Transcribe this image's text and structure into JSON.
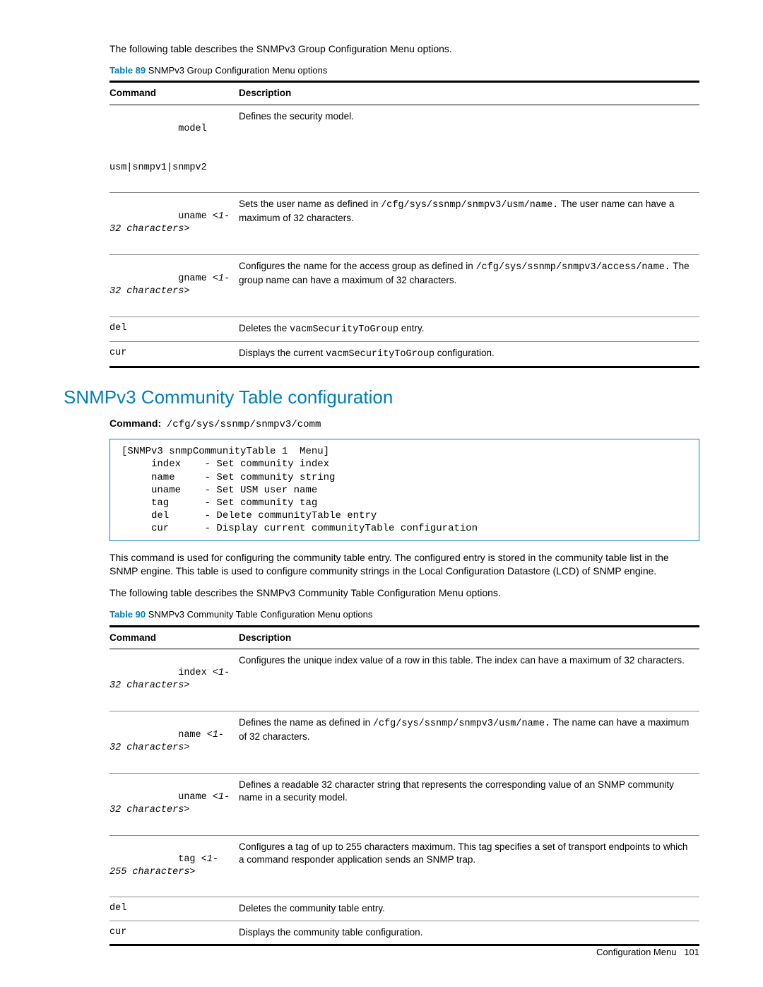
{
  "para_intro": "The following table describes the SNMPv3 Group Configuration Menu options.",
  "table89": {
    "caption_num": "Table 89",
    "caption_text": "SNMPv3 Group Configuration Menu options",
    "head_cmd": "Command",
    "head_desc": "Description",
    "rows": {
      "r0": {
        "cmd1": "model",
        "cmd2": "usm|snmpv1|snmpv2",
        "desc": "Defines the security model."
      },
      "r1": {
        "cmd1": "uname ",
        "cmd2a": "<1-32 characters>",
        "desc1": "Sets the user name as defined in ",
        "desc_code": "/cfg/sys/ssnmp/snmpv3/usm/name.",
        "desc2": " The user name can have a maximum of 32 characters."
      },
      "r2": {
        "cmd1": "gname ",
        "cmd2a": "<1-32 characters>",
        "desc1": "Configures the name for the access group as defined in ",
        "desc_code": "/cfg/sys/ssnmp/snmpv3/access/name.",
        "desc2": " The group name can have a maximum of 32 characters."
      },
      "r3": {
        "cmd": "del",
        "desc1": "Deletes the ",
        "desc_code": "vacmSecurityToGroup",
        "desc2": " entry."
      },
      "r4": {
        "cmd": "cur",
        "desc1": "Displays the current ",
        "desc_code": "vacmSecurityToGroup",
        "desc2": " configuration."
      }
    }
  },
  "section_heading": "SNMPv3 Community Table configuration",
  "cmd_label": "Command:",
  "cmd_path": "/cfg/sys/ssnmp/snmpv3/comm",
  "codebox": "[SNMPv3 snmpCommunityTable 1  Menu]\n     index    - Set community index\n     name     - Set community string\n     uname    - Set USM user name\n     tag      - Set community tag\n     del      - Delete communityTable entry\n     cur      - Display current communityTable configuration",
  "para_after_code": "This command is used for configuring the community table entry. The configured entry is stored in the community table list in the SNMP engine. This table is used to configure community strings in the Local Configuration Datastore (LCD) of SNMP engine.",
  "para_table90_intro": "The following table describes the SNMPv3 Community Table Configuration Menu options.",
  "table90": {
    "caption_num": "Table 90",
    "caption_text": "SNMPv3 Community Table Configuration Menu options",
    "head_cmd": "Command",
    "head_desc": "Description",
    "rows": {
      "r0": {
        "cmd1": "index ",
        "cmd2a": "<1-32 characters>",
        "desc": "Configures the unique index value of a row in this table. The index can have a maximum of 32 characters."
      },
      "r1": {
        "cmd1": "name ",
        "cmd2a": "<1-32 characters>",
        "desc1": "Defines the name as defined in ",
        "desc_code": "/cfg/sys/ssnmp/snmpv3/usm/name.",
        "desc2": " The name can have a maximum of 32 characters."
      },
      "r2": {
        "cmd1": "uname ",
        "cmd2a": "<1-32 characters>",
        "desc": "Defines a readable 32 character string that represents the corresponding value of an SNMP community name in a security model."
      },
      "r3": {
        "cmd1": "tag ",
        "cmd2a": "<1-255 characters>",
        "desc": "Configures a tag of up to 255 characters maximum. This tag specifies a set of transport endpoints to which a command responder application sends an SNMP trap."
      },
      "r4": {
        "cmd": "del",
        "desc": "Deletes the community table entry."
      },
      "r5": {
        "cmd": "cur",
        "desc": "Displays the community table configuration."
      }
    }
  },
  "footer_text": "Configuration Menu",
  "footer_page": "101"
}
